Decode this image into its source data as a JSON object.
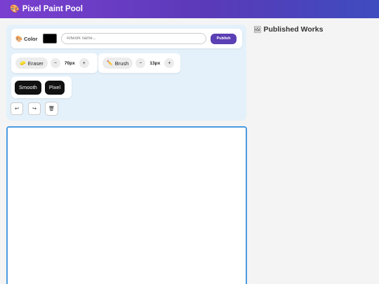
{
  "app": {
    "title": "Pixel Paint Pool",
    "logo_icon": "🎨"
  },
  "toolbar": {
    "color_label": "Color",
    "color_icon": "🎨",
    "current_color": "#000000",
    "artwork_name": {
      "value": "",
      "placeholder": "Artwork name..."
    },
    "publish_label": "Publish"
  },
  "eraser": {
    "label": "Eraser",
    "icon": "🧽",
    "size": "70px",
    "minus": "−",
    "plus": "+"
  },
  "brush": {
    "label": "Brush",
    "icon": "✏️",
    "size": "13px",
    "minus": "−",
    "plus": "+"
  },
  "modes": [
    {
      "label": "Smooth"
    },
    {
      "label": "Pixel"
    }
  ],
  "actions": {
    "undo": "↩",
    "redo": "↪",
    "clear": "🗑"
  },
  "gallery": {
    "title": "Published Works",
    "icon": "🖼"
  },
  "colors": {
    "accent": "#5b3fb4",
    "canvas_border": "#4a9be0",
    "panel_bg": "#e4f1fb"
  }
}
